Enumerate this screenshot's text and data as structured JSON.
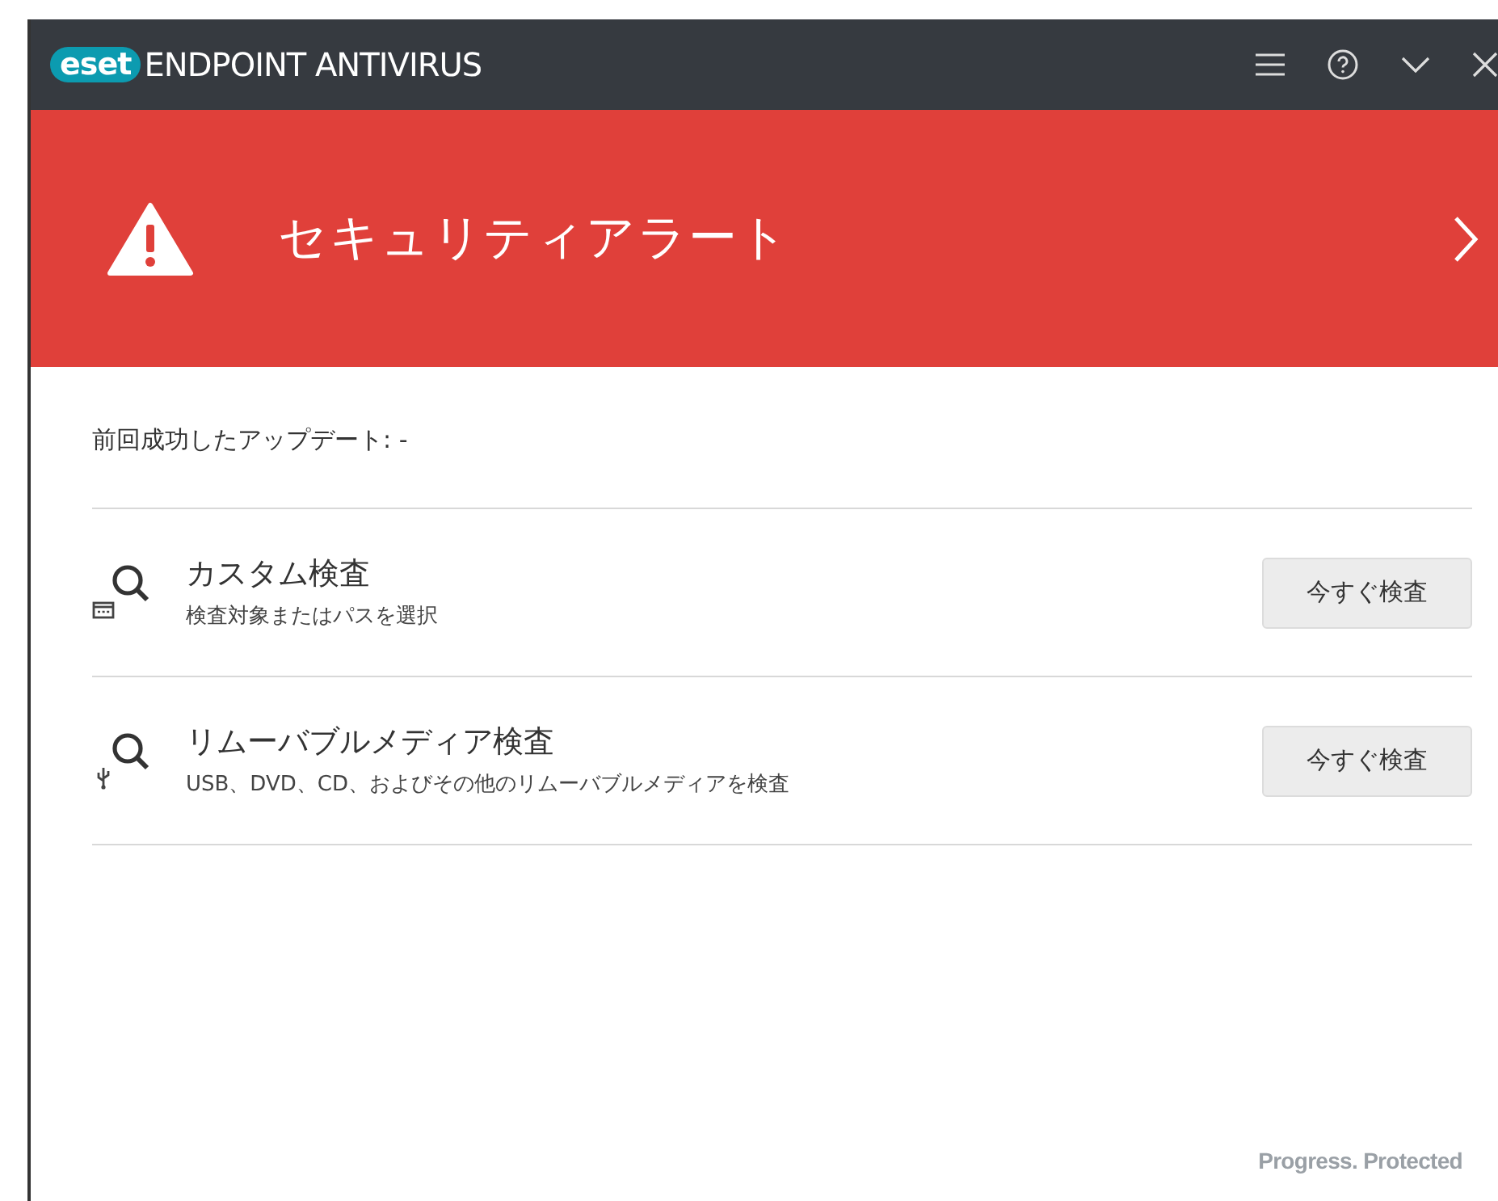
{
  "window": {
    "logo": "eset",
    "title": "ENDPOINT ANTIVIRUS"
  },
  "alert": {
    "title": "セキュリティアラート"
  },
  "last_update": "前回成功したアップデート: -",
  "scans": [
    {
      "kind": "custom",
      "title": "カスタム検査",
      "description": "検査対象またはパスを選択",
      "button": "今すぐ検査"
    },
    {
      "kind": "removable",
      "title": "リムーバブルメディア検査",
      "description": "USB、DVD、CD、およびその他のリムーバブルメディアを検査",
      "button": "今すぐ検査"
    }
  ],
  "footer": "Progress. Protected"
}
